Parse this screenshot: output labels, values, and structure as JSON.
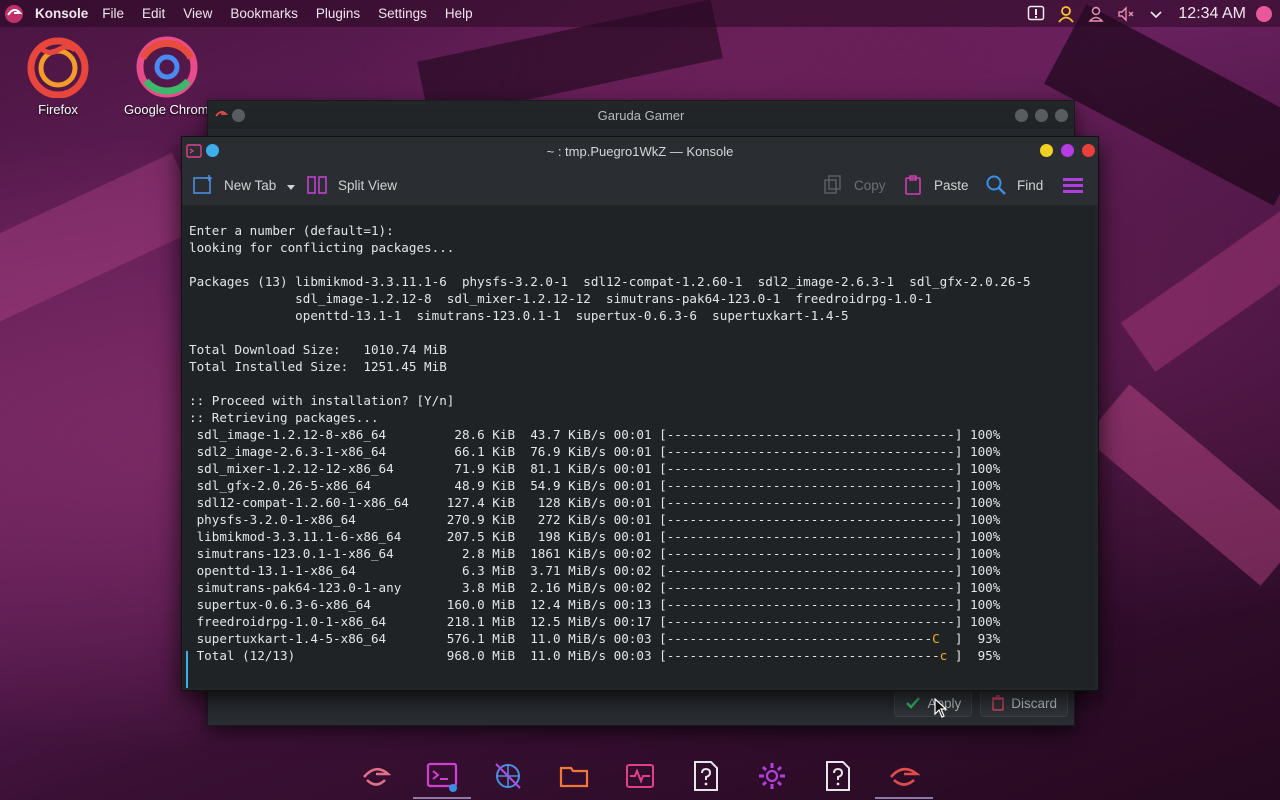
{
  "topbar": {
    "app_name": "Konsole",
    "menus": [
      "File",
      "Edit",
      "View",
      "Bookmarks",
      "Plugins",
      "Settings",
      "Help"
    ],
    "clock": "12:34 AM"
  },
  "desktop": {
    "icons": [
      {
        "label": "Firefox",
        "icon": "firefox-icon"
      },
      {
        "label": "Google Chrome",
        "icon": "chrome-icon"
      }
    ]
  },
  "back_window": {
    "title": "Garuda Gamer",
    "apply_label": "Apply",
    "discard_label": "Discard"
  },
  "konsole": {
    "title": "~ : tmp.Puegro1WkZ — Konsole",
    "toolbar": {
      "new_tab": "New Tab",
      "split_view": "Split View",
      "copy": "Copy",
      "paste": "Paste",
      "find": "Find"
    },
    "terminal": {
      "header_lines": [
        "Enter a number (default=1):",
        "looking for conflicting packages...",
        "",
        "Packages (13) libmikmod-3.3.11.1-6  physfs-3.2.0-1  sdl12-compat-1.2.60-1  sdl2_image-2.6.3-1  sdl_gfx-2.0.26-5",
        "              sdl_image-1.2.12-8  sdl_mixer-1.2.12-12  simutrans-pak64-123.0-1  freedroidrpg-1.0-1",
        "              openttd-13.1-1  simutrans-123.0.1-1  supertux-0.6.3-6  supertuxkart-1.4-5",
        "",
        "Total Download Size:   1010.74 MiB",
        "Total Installed Size:  1251.45 MiB",
        "",
        ":: Proceed with installation? [Y/n]",
        ":: Retrieving packages..."
      ],
      "downloads": [
        {
          "name": "sdl_image-1.2.12-8-x86_64",
          "size": "28.6 KiB",
          "rate": "43.7 KiB/s",
          "time": "00:01",
          "bar": "[--------------------------------------]",
          "pct": "100%"
        },
        {
          "name": "sdl2_image-2.6.3-1-x86_64",
          "size": "66.1 KiB",
          "rate": "76.9 KiB/s",
          "time": "00:01",
          "bar": "[--------------------------------------]",
          "pct": "100%"
        },
        {
          "name": "sdl_mixer-1.2.12-12-x86_64",
          "size": "71.9 KiB",
          "rate": "81.1 KiB/s",
          "time": "00:01",
          "bar": "[--------------------------------------]",
          "pct": "100%"
        },
        {
          "name": "sdl_gfx-2.0.26-5-x86_64",
          "size": "48.9 KiB",
          "rate": "54.9 KiB/s",
          "time": "00:01",
          "bar": "[--------------------------------------]",
          "pct": "100%"
        },
        {
          "name": "sdl12-compat-1.2.60-1-x86_64",
          "size": "127.4 KiB",
          "rate": "128 KiB/s",
          "time": "00:01",
          "bar": "[--------------------------------------]",
          "pct": "100%"
        },
        {
          "name": "physfs-3.2.0-1-x86_64",
          "size": "270.9 KiB",
          "rate": "272 KiB/s",
          "time": "00:01",
          "bar": "[--------------------------------------]",
          "pct": "100%"
        },
        {
          "name": "libmikmod-3.3.11.1-6-x86_64",
          "size": "207.5 KiB",
          "rate": "198 KiB/s",
          "time": "00:01",
          "bar": "[--------------------------------------]",
          "pct": "100%"
        },
        {
          "name": "simutrans-123.0.1-1-x86_64",
          "size": "2.8 MiB",
          "rate": "1861 KiB/s",
          "time": "00:02",
          "bar": "[--------------------------------------]",
          "pct": "100%"
        },
        {
          "name": "openttd-13.1-1-x86_64",
          "size": "6.3 MiB",
          "rate": "3.71 MiB/s",
          "time": "00:02",
          "bar": "[--------------------------------------]",
          "pct": "100%"
        },
        {
          "name": "simutrans-pak64-123.0-1-any",
          "size": "3.8 MiB",
          "rate": "2.16 MiB/s",
          "time": "00:02",
          "bar": "[--------------------------------------]",
          "pct": "100%"
        },
        {
          "name": "supertux-0.6.3-6-x86_64",
          "size": "160.0 MiB",
          "rate": "12.4 MiB/s",
          "time": "00:13",
          "bar": "[--------------------------------------]",
          "pct": "100%"
        },
        {
          "name": "freedroidrpg-1.0-1-x86_64",
          "size": "218.1 MiB",
          "rate": "12.5 MiB/s",
          "time": "00:17",
          "bar": "[--------------------------------------]",
          "pct": "100%"
        },
        {
          "name": "supertuxkart-1.4-5-x86_64",
          "size": "576.1 MiB",
          "rate": "11.0 MiB/s",
          "time": "00:03",
          "bar_done": "[-----------------------------------",
          "bar_pac": "C",
          "bar_rest": "  ]",
          "pct": "93%"
        },
        {
          "name": "Total (12/13)",
          "size": "968.0 MiB",
          "rate": "11.0 MiB/s",
          "time": "00:03",
          "bar_done": "[------------------------------------",
          "bar_pac": "c",
          "bar_rest": " ]",
          "pct": "95%"
        }
      ]
    }
  },
  "dock": {
    "items": [
      "garuda-launcher-icon",
      "konsole-icon",
      "network-icon",
      "folder-icon",
      "system-monitor-icon",
      "help-icon",
      "settings-icon",
      "help-icon-2",
      "garuda-gamer-icon"
    ],
    "active_index": 1
  },
  "colors": {
    "accent": "#3daee9",
    "pacman": "#f0b020",
    "icon_pink": "#e0408a",
    "icon_purple": "#b040e0"
  }
}
